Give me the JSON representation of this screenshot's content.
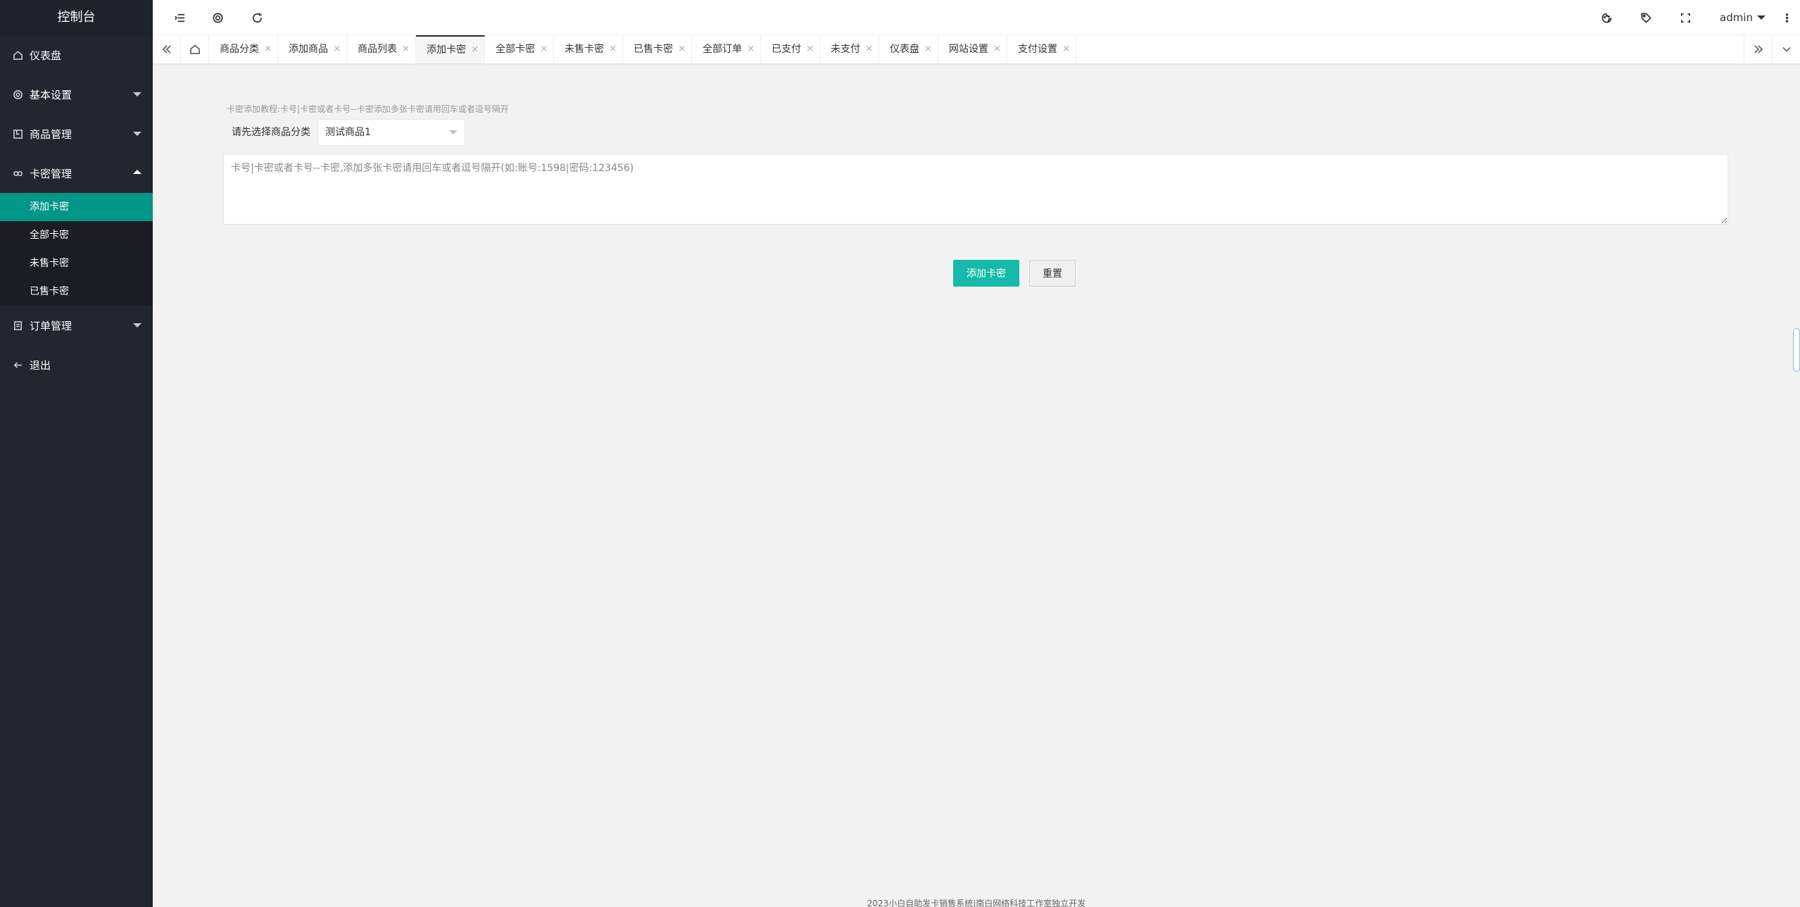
{
  "sidebar": {
    "logo": "控制台",
    "items": [
      {
        "label": "仪表盘",
        "icon": "home-icon"
      },
      {
        "label": "基本设置",
        "icon": "gear-icon"
      },
      {
        "label": "商品管理",
        "icon": "shop-icon"
      },
      {
        "label": "卡密管理",
        "icon": "key-icon",
        "expanded": true
      },
      {
        "label": "订单管理",
        "icon": "order-icon"
      },
      {
        "label": "退出",
        "icon": "arrow-left-icon"
      }
    ],
    "sub_items": [
      {
        "label": "添加卡密",
        "active": true
      },
      {
        "label": "全部卡密"
      },
      {
        "label": "未售卡密"
      },
      {
        "label": "已售卡密"
      }
    ]
  },
  "header": {
    "user": "admin"
  },
  "tabs": [
    {
      "label": "商品分类",
      "close": "×"
    },
    {
      "label": "添加商品",
      "close": "×"
    },
    {
      "label": "商品列表",
      "close": "×"
    },
    {
      "label": "添加卡密",
      "close": "×",
      "active": true
    },
    {
      "label": "全部卡密",
      "close": "×"
    },
    {
      "label": "未售卡密",
      "close": "×"
    },
    {
      "label": "已售卡密",
      "close": "×"
    },
    {
      "label": "全部订单",
      "close": "×"
    },
    {
      "label": "已支付",
      "close": "×"
    },
    {
      "label": "未支付",
      "close": "×"
    },
    {
      "label": "仪表盘",
      "close": "×"
    },
    {
      "label": "网站设置",
      "close": "×"
    },
    {
      "label": "支付设置",
      "close": "×"
    }
  ],
  "form": {
    "hint": "卡密添加教程:卡号|卡密或者卡号--卡密添加多张卡密请用回车或者逗号隔开",
    "category_label": "请先选择商品分类",
    "category_value": "测试商品1",
    "textarea_placeholder": "卡号|卡密或者卡号--卡密,添加多张卡密请用回车或者逗号隔开(如:账号:1598|密码:123456)",
    "submit_label": "添加卡密",
    "reset_label": "重置"
  },
  "footer": "2023小白自助发卡销售系统|南白网络科技工作室独立开发",
  "colors": {
    "sidebar_bg": "#23262e",
    "active_item": "#009688",
    "primary_button": "#16baaa"
  }
}
